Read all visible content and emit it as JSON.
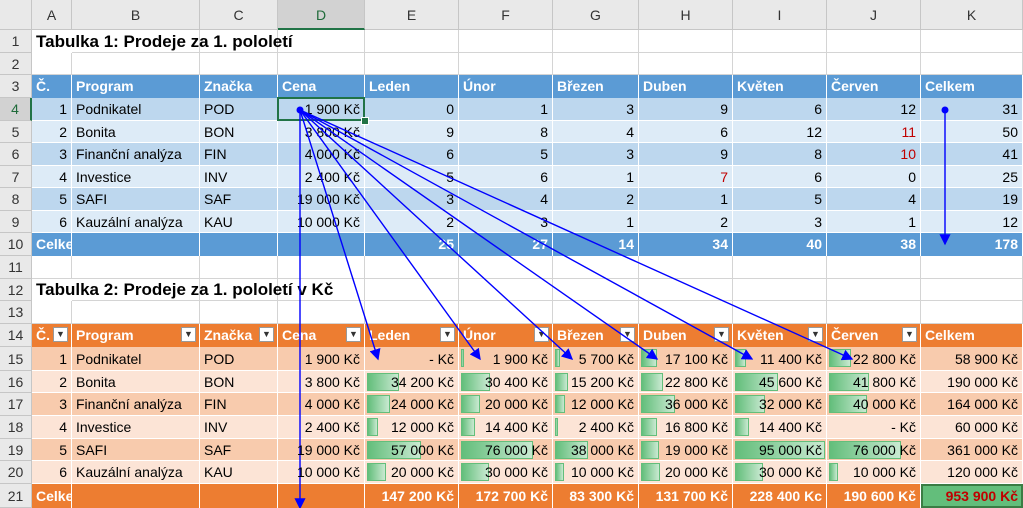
{
  "columns": [
    "A",
    "B",
    "C",
    "D",
    "E",
    "F",
    "G",
    "H",
    "I",
    "J",
    "K"
  ],
  "selected_column": "D",
  "selected_row": "4",
  "rows": [
    "1",
    "2",
    "3",
    "4",
    "5",
    "6",
    "7",
    "8",
    "9",
    "10",
    "11",
    "12",
    "13",
    "14",
    "15",
    "16",
    "17",
    "18",
    "19",
    "20",
    "21"
  ],
  "table1": {
    "title": "Tabulka 1: Prodeje za 1. pololetí",
    "headers": [
      "Č.",
      "Program",
      "Značka",
      "Cena",
      "Leden",
      "Únor",
      "Březen",
      "Duben",
      "Květen",
      "Červen",
      "Celkem"
    ],
    "rows": [
      [
        "1",
        "Podnikatel",
        "POD",
        "1 900 Kč",
        "0",
        "1",
        "3",
        "9",
        "6",
        "12",
        "31"
      ],
      [
        "2",
        "Bonita",
        "BON",
        "3 800 Kč",
        "9",
        "8",
        "4",
        "6",
        "12",
        "11",
        "50"
      ],
      [
        "3",
        "Finanční analýza",
        "FIN",
        "4 000 Kč",
        "6",
        "5",
        "3",
        "9",
        "8",
        "10",
        "41"
      ],
      [
        "4",
        "Investice",
        "INV",
        "2 400 Kč",
        "5",
        "6",
        "1",
        "7",
        "6",
        "0",
        "25"
      ],
      [
        "5",
        "SAFI",
        "SAF",
        "19 000 Kč",
        "3",
        "4",
        "2",
        "1",
        "5",
        "4",
        "19"
      ],
      [
        "6",
        "Kauzální analýza",
        "KAU",
        "10 000 Kč",
        "2",
        "3",
        "1",
        "2",
        "3",
        "1",
        "12"
      ]
    ],
    "total_row": [
      "Celkem",
      "",
      "",
      "",
      "25",
      "27",
      "14",
      "34",
      "40",
      "38",
      "178"
    ]
  },
  "table2": {
    "title": "Tabulka 2: Prodeje za 1. pololetí v Kč",
    "headers": [
      "Č.",
      "Program",
      "Značka",
      "Cena",
      "Leden",
      "Únor",
      "Březen",
      "Duben",
      "Květen",
      "Červen",
      "Celkem"
    ],
    "rows": [
      [
        "1",
        "Podnikatel",
        "POD",
        "1 900 Kč",
        "-     Kč",
        "1 900 Kč",
        "5 700 Kč",
        "17 100 Kč",
        "11 400 Kč",
        "22 800 Kč",
        "58 900 Kč"
      ],
      [
        "2",
        "Bonita",
        "BON",
        "3 800 Kč",
        "34 200 Kč",
        "30 400 Kč",
        "15 200 Kč",
        "22 800 Kč",
        "45 600 Kč",
        "41 800 Kč",
        "190 000 Kč"
      ],
      [
        "3",
        "Finanční analýza",
        "FIN",
        "4 000 Kč",
        "24 000 Kč",
        "20 000 Kč",
        "12 000 Kč",
        "36 000 Kč",
        "32 000 Kč",
        "40 000 Kč",
        "164 000 Kč"
      ],
      [
        "4",
        "Investice",
        "INV",
        "2 400 Kč",
        "12 000 Kč",
        "14 400 Kč",
        "2 400 Kč",
        "16 800 Kč",
        "14 400 Kč",
        "-     Kč",
        "60 000 Kč"
      ],
      [
        "5",
        "SAFI",
        "SAF",
        "19 000 Kč",
        "57 000 Kč",
        "76 000 Kč",
        "38 000 Kč",
        "19 000 Kč",
        "95 000 Kč",
        "76 000 Kč",
        "361 000 Kč"
      ],
      [
        "6",
        "Kauzální analýza",
        "KAU",
        "10 000 Kč",
        "20 000 Kč",
        "30 000 Kč",
        "10 000 Kč",
        "20 000 Kč",
        "30 000 Kč",
        "10 000 Kč",
        "120 000 Kč"
      ]
    ],
    "data_bar_values": [
      [
        0,
        1900,
        5700,
        17100,
        11400,
        22800
      ],
      [
        34200,
        30400,
        15200,
        22800,
        45600,
        41800
      ],
      [
        24000,
        20000,
        12000,
        36000,
        32000,
        40000
      ],
      [
        12000,
        14400,
        2400,
        16800,
        14400,
        0
      ],
      [
        57000,
        76000,
        38000,
        19000,
        95000,
        76000
      ],
      [
        20000,
        30000,
        10000,
        20000,
        30000,
        10000
      ]
    ],
    "total_row": [
      "Celkem",
      "",
      "",
      "",
      "147 200 Kč",
      "172 700 Kč",
      "83 300 Kč",
      "131 700 Kč",
      "228 400 Kc",
      "190 600 Kč",
      "953 900 Kč"
    ]
  },
  "colors": {
    "blue_header": "#5b9bd5",
    "blue_band1": "#bdd7ee",
    "blue_band2": "#ddebf7",
    "orange_header": "#ed7d31",
    "orange_band1": "#f8cbad",
    "orange_band2": "#fce4d6",
    "data_bar": "#63be7b",
    "trace_arrow": "#0000ff",
    "red_text": "#c00000"
  },
  "red_cells": [
    [
      "5",
      "J"
    ],
    [
      "6",
      "J"
    ],
    [
      "7",
      "H"
    ]
  ],
  "dropdown_icon": "filter-dropdown-icon"
}
